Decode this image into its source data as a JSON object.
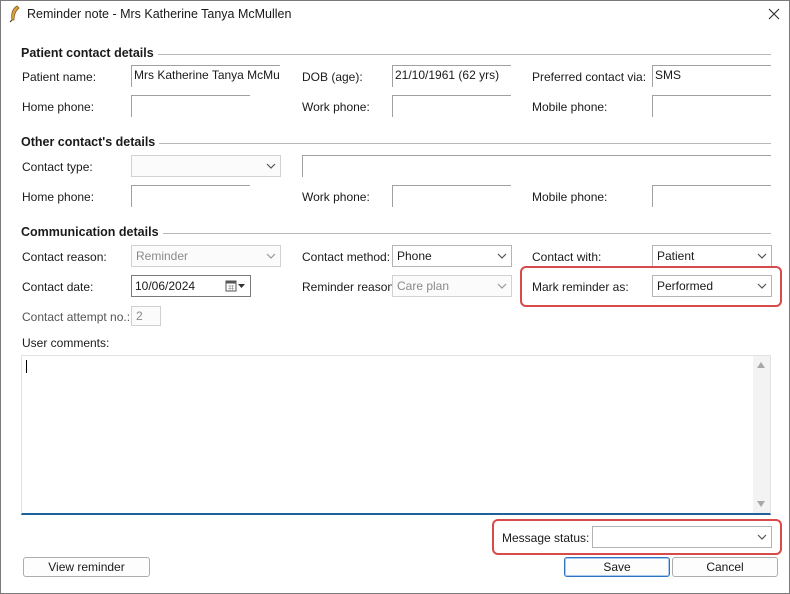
{
  "window": {
    "title": "Reminder note - Mrs Katherine Tanya McMullen"
  },
  "patient_contact": {
    "heading": "Patient contact details",
    "patient_name_label": "Patient name:",
    "patient_name": "Mrs Katherine Tanya McMullen",
    "dob_label": "DOB (age):",
    "dob": "21/10/1961 (62 yrs)",
    "preferred_label": "Preferred contact via:",
    "preferred": "SMS",
    "home_phone_label": "Home phone:",
    "home_phone": "",
    "work_phone_label": "Work phone:",
    "work_phone": "",
    "mobile_phone_label": "Mobile phone:",
    "mobile_phone": ""
  },
  "other_contact": {
    "heading": "Other contact's details",
    "contact_type_label": "Contact type:",
    "contact_type": "",
    "contact_name": "",
    "home_phone_label": "Home phone:",
    "home_phone": "",
    "work_phone_label": "Work phone:",
    "work_phone": "",
    "mobile_phone_label": "Mobile phone:",
    "mobile_phone": ""
  },
  "communication": {
    "heading": "Communication details",
    "contact_reason_label": "Contact reason:",
    "contact_reason": "Reminder",
    "contact_method_label": "Contact method:",
    "contact_method": "Phone",
    "contact_with_label": "Contact with:",
    "contact_with": "Patient",
    "contact_date_label": "Contact date:",
    "contact_date": "10/06/2024",
    "reminder_reason_label": "Reminder reason:",
    "reminder_reason": "Care plan",
    "mark_reminder_label": "Mark reminder as:",
    "mark_reminder": "Performed",
    "attempt_label": "Contact attempt no.:",
    "attempt": "2",
    "user_comments_label": "User comments:",
    "user_comments": ""
  },
  "footer": {
    "message_status_label": "Message status:",
    "message_status": "",
    "view_reminder_label": "View reminder",
    "save_label": "Save",
    "cancel_label": "Cancel"
  },
  "colors": {
    "highlight": "#d94a4a",
    "memo_underline": "#1f5f9a",
    "default_button": "#2f74c0"
  }
}
